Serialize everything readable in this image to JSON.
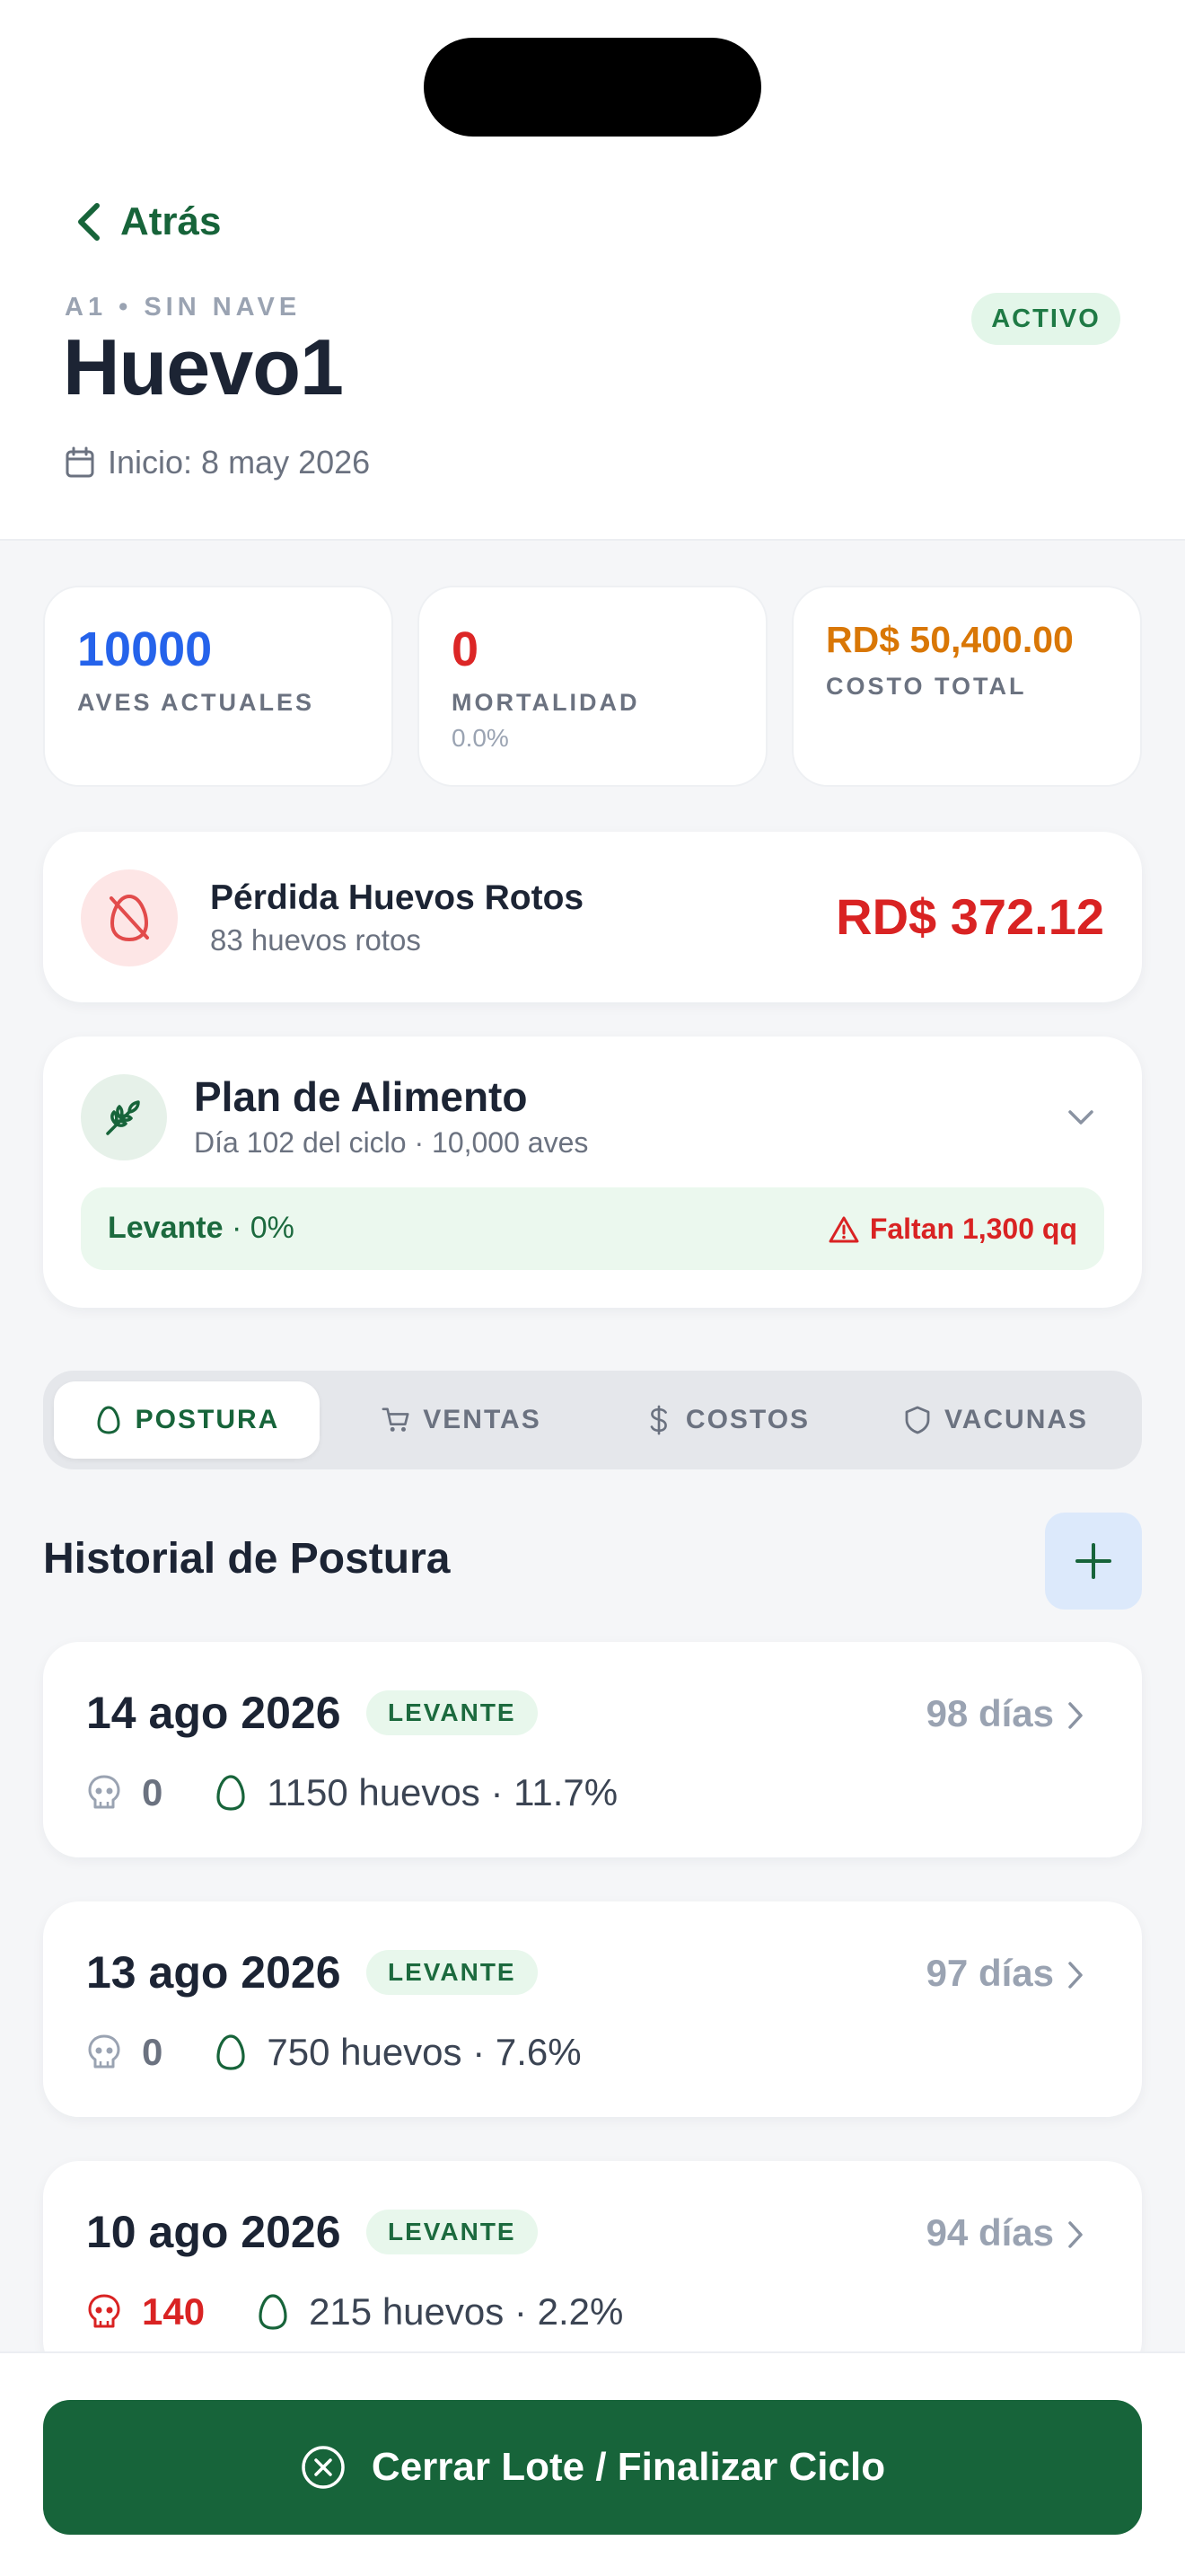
{
  "header": {
    "back_label": "Atrás",
    "subtitle": "A1 • SIN NAVE",
    "title": "Huevo1",
    "start_label": "Inicio: 8 may 2026",
    "status": "ACTIVO"
  },
  "stats": [
    {
      "value": "10000",
      "label": "AVES ACTUALES",
      "sub": "",
      "color": "#2563eb"
    },
    {
      "value": "0",
      "label": "MORTALIDAD",
      "sub": "0.0%",
      "color": "#dc2626"
    },
    {
      "value": "RD$ 50,400.00",
      "label": "COSTO TOTAL",
      "sub": "",
      "color": "#d97706"
    }
  ],
  "loss": {
    "title": "Pérdida Huevos Rotos",
    "subtitle": "83 huevos rotos",
    "value": "RD$ 372.12",
    "icon": "broken-egg-icon"
  },
  "feed": {
    "title": "Plan de Alimento",
    "subtitle": "Día 102 del ciclo · 10,000 aves",
    "stage": "Levante",
    "stage_pct": " · 0%",
    "warning": "Faltan 1,300 qq",
    "icon": "wheat-icon"
  },
  "tabs": [
    {
      "label": "POSTURA",
      "icon": "egg-icon",
      "active": true
    },
    {
      "label": "VENTAS",
      "icon": "cart-icon",
      "active": false
    },
    {
      "label": "COSTOS",
      "icon": "dollar-icon",
      "active": false
    },
    {
      "label": "VACUNAS",
      "icon": "shield-icon",
      "active": false
    }
  ],
  "history": {
    "title": "Historial de Postura",
    "records": [
      {
        "date": "14 ago 2026",
        "stage": "LEVANTE",
        "days": "98 días",
        "mortality": "0",
        "eggs": "1150 huevos · 11.7%"
      },
      {
        "date": "13 ago 2026",
        "stage": "LEVANTE",
        "days": "97 días",
        "mortality": "0",
        "eggs": "750 huevos · 7.6%"
      },
      {
        "date": "10 ago 2026",
        "stage": "LEVANTE",
        "days": "94 días",
        "mortality": "140",
        "eggs": "215 huevos · 2.2%"
      }
    ]
  },
  "footer": {
    "close_label": "Cerrar Lote / Finalizar Ciclo"
  },
  "colors": {
    "brand_green": "#17643a",
    "danger_red": "#d92323",
    "accent_blue": "#2563eb",
    "accent_orange": "#d97706"
  }
}
